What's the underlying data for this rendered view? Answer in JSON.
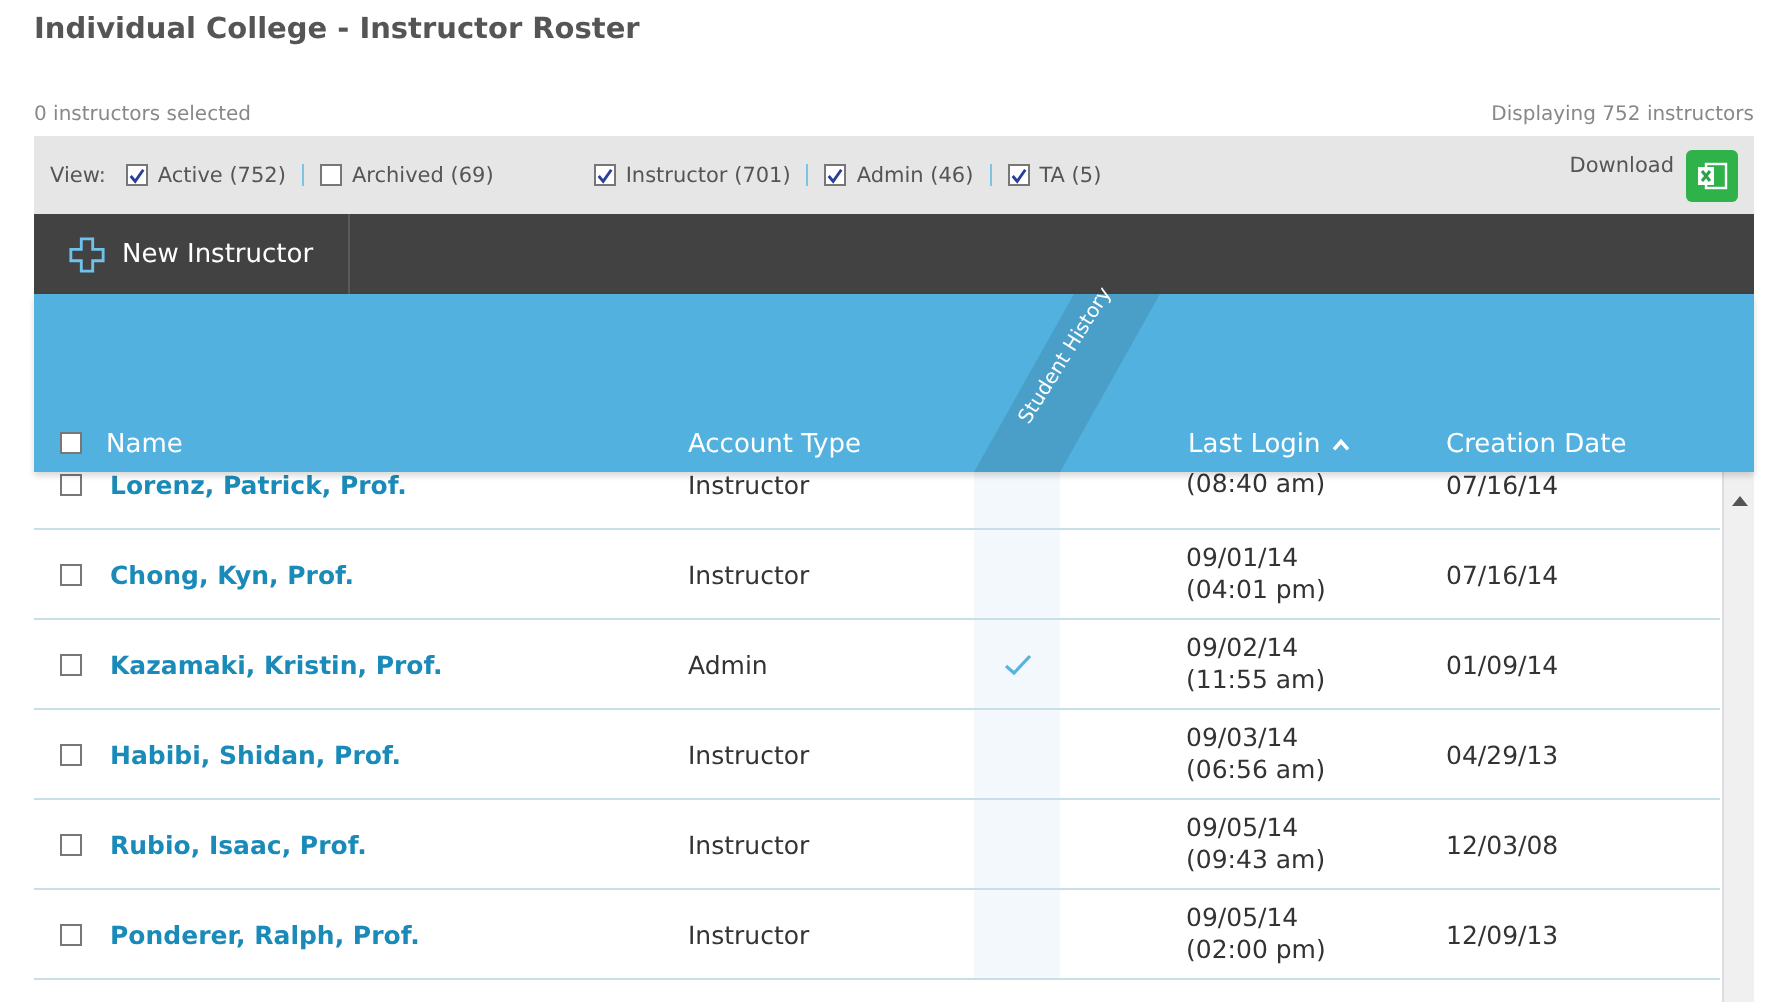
{
  "page_title": "Individual College - Instructor Roster",
  "selection_info": "0 instructors selected",
  "display_info": "Displaying 752 instructors",
  "filter_bar": {
    "view_label": "View:",
    "groups": [
      [
        {
          "label": "Active (752)",
          "checked": true
        },
        {
          "label": "Archived (69)",
          "checked": false
        }
      ],
      [
        {
          "label": "Instructor (701)",
          "checked": true
        },
        {
          "label": "Admin (46)",
          "checked": true
        },
        {
          "label": "TA (5)",
          "checked": true
        }
      ]
    ],
    "download_label": "Download"
  },
  "toolbar": {
    "new_button": "New Instructor"
  },
  "table": {
    "select_all_checked": false,
    "columns": [
      {
        "label": "Name",
        "sorted": false
      },
      {
        "label": "Account Type",
        "sorted": false
      },
      {
        "label": "Student History",
        "sorted": false
      },
      {
        "label": "Last Login",
        "sorted": true
      },
      {
        "label": "Creation Date",
        "sorted": false
      }
    ],
    "rows": [
      {
        "checked": false,
        "name": "Lorenz, Patrick, Prof.",
        "account_type": "Instructor",
        "student_history": false,
        "last_login": [
          "(08:40 am)"
        ],
        "creation_date": "07/16/14"
      },
      {
        "checked": false,
        "name": "Chong, Kyn, Prof.",
        "account_type": "Instructor",
        "student_history": false,
        "last_login": [
          "09/01/14",
          "(04:01 pm)"
        ],
        "creation_date": "07/16/14"
      },
      {
        "checked": false,
        "name": "Kazamaki, Kristin, Prof.",
        "account_type": "Admin",
        "student_history": true,
        "last_login": [
          "09/02/14",
          "(11:55 am)"
        ],
        "creation_date": "01/09/14"
      },
      {
        "checked": false,
        "name": "Habibi, Shidan, Prof.",
        "account_type": "Instructor",
        "student_history": false,
        "last_login": [
          "09/03/14",
          "(06:56 am)"
        ],
        "creation_date": "04/29/13"
      },
      {
        "checked": false,
        "name": "Rubio, Isaac, Prof.",
        "account_type": "Instructor",
        "student_history": false,
        "last_login": [
          "09/05/14",
          "(09:43 am)"
        ],
        "creation_date": "12/03/08"
      },
      {
        "checked": false,
        "name": "Ponderer, Ralph, Prof.",
        "account_type": "Instructor",
        "student_history": false,
        "last_login": [
          "09/05/14",
          "(02:00 pm)"
        ],
        "creation_date": "12/09/13"
      }
    ]
  }
}
